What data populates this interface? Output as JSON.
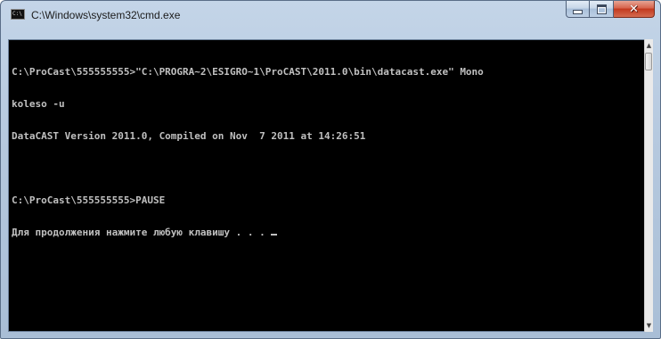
{
  "window": {
    "title": "C:\\Windows\\system32\\cmd.exe",
    "icon_text": "C:\\"
  },
  "caption_buttons": {
    "minimize": "minimize-icon",
    "maximize": "maximize-icon",
    "close": "close-icon",
    "close_glyph": "✕"
  },
  "console": {
    "lines": [
      "C:\\ProCast\\555555555>\"C:\\PROGRA~2\\ESIGRO~1\\ProCAST\\2011.0\\bin\\datacast.exe\" Mono",
      "koleso -u",
      "DataCAST Version 2011.0, Compiled on Nov  7 2011 at 14:26:51",
      "",
      "C:\\ProCast\\555555555>PAUSE",
      "Для продолжения нажмите любую клавишу . . . "
    ]
  },
  "scrollbar": {
    "up_arrow": "▲",
    "down_arrow": "▼"
  },
  "colors": {
    "console_bg": "#000000",
    "console_text": "#c0c0c0",
    "close_button": "#c2391e"
  }
}
